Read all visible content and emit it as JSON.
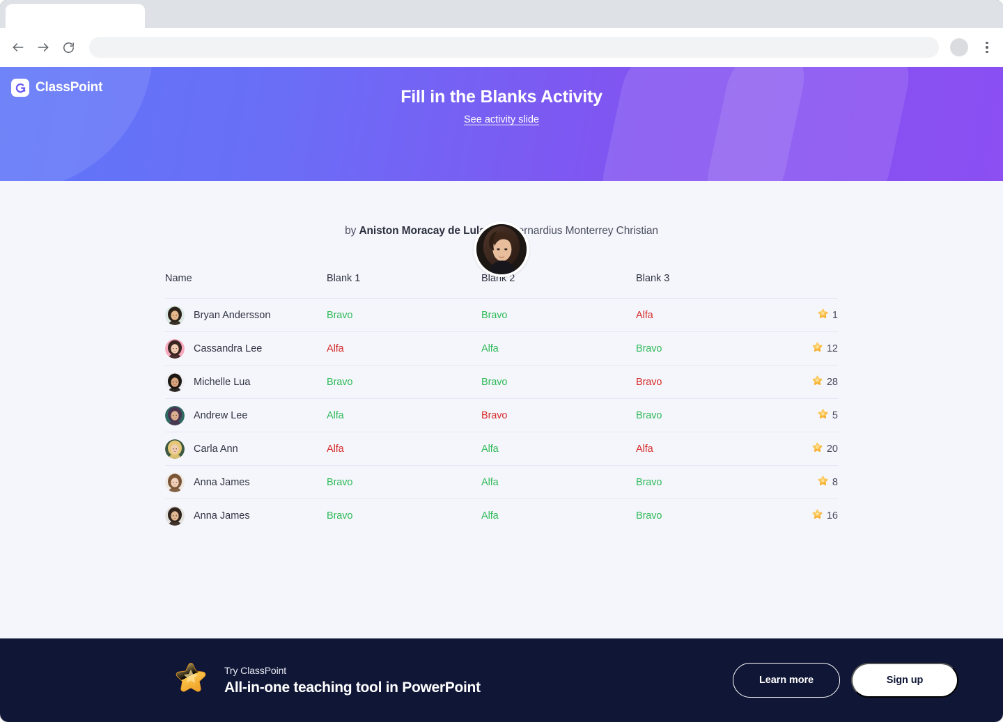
{
  "browser": {
    "tab_title": "",
    "url": "",
    "url_placeholder": "",
    "back_icon": "back-arrow-icon",
    "forward_icon": "forward-arrow-icon",
    "reload_icon": "reload-icon",
    "profile_icon": "profile-avatar-icon",
    "menu_icon": "kebab-menu-icon"
  },
  "header": {
    "brand": "ClassPoint",
    "brand_mark": "classpoint-logo-icon",
    "title": "Fill in the Blanks Activity",
    "link_label": "See activity slide",
    "avatar_alt": "presenter-avatar",
    "gradient_from": "#5f76f8",
    "gradient_to": "#8b4ff2"
  },
  "byline": {
    "prefix": "by",
    "author": "Aniston Moracay de Lula",
    "separator": "|",
    "school": "St. Bernardius Monterrey Christian"
  },
  "table": {
    "columns": [
      "Name",
      "Blank 1",
      "Blank 2",
      "Blank 3",
      ""
    ],
    "rows": [
      {
        "name": "Bryan Andersson",
        "avatar_colors": [
          "#dbe8e4",
          "#2b2218",
          "#e8b98f"
        ],
        "answers": [
          {
            "text": "Bravo",
            "correct": true
          },
          {
            "text": "Bravo",
            "correct": true
          },
          {
            "text": "Alfa",
            "correct": false
          }
        ],
        "score": "1"
      },
      {
        "name": "Cassandra Lee",
        "avatar_colors": [
          "#f7a8bd",
          "#3a2420",
          "#f2cdb4"
        ],
        "answers": [
          {
            "text": "Alfa",
            "correct": false
          },
          {
            "text": "Alfa",
            "correct": true
          },
          {
            "text": "Bravo",
            "correct": true
          }
        ],
        "score": "12"
      },
      {
        "name": "Michelle Lua",
        "avatar_colors": [
          "#efeef2",
          "#1d1713",
          "#d9a57e"
        ],
        "answers": [
          {
            "text": "Bravo",
            "correct": true
          },
          {
            "text": "Bravo",
            "correct": true
          },
          {
            "text": "Bravo",
            "correct": false
          }
        ],
        "score": "28"
      },
      {
        "name": "Andrew Lee",
        "avatar_colors": [
          "#2f6a63",
          "#4a3550",
          "#dcae90"
        ],
        "answers": [
          {
            "text": "Alfa",
            "correct": true
          },
          {
            "text": "Bravo",
            "correct": false
          },
          {
            "text": "Bravo",
            "correct": true
          }
        ],
        "score": "5"
      },
      {
        "name": "Carla Ann",
        "avatar_colors": [
          "#3f5a43",
          "#e5c877",
          "#f0cdb2"
        ],
        "answers": [
          {
            "text": "Alfa",
            "correct": false
          },
          {
            "text": "Alfa",
            "correct": true
          },
          {
            "text": "Alfa",
            "correct": false
          }
        ],
        "score": "20"
      },
      {
        "name": "Anna James",
        "avatar_colors": [
          "#efe9e4",
          "#7b5636",
          "#f3d2bc"
        ],
        "answers": [
          {
            "text": "Bravo",
            "correct": true
          },
          {
            "text": "Alfa",
            "correct": true
          },
          {
            "text": "Bravo",
            "correct": true
          }
        ],
        "score": "8"
      },
      {
        "name": "Anna James",
        "avatar_colors": [
          "#e4e2df",
          "#31241c",
          "#e0b892"
        ],
        "answers": [
          {
            "text": "Bravo",
            "correct": true
          },
          {
            "text": "Alfa",
            "correct": true
          },
          {
            "text": "Bravo",
            "correct": true
          }
        ],
        "score": "16"
      }
    ],
    "correct_color": "#2fba5a",
    "wrong_color": "#d52b2b",
    "star_icon": "star-icon"
  },
  "banner": {
    "star_icon": "gold-star-icon",
    "kicker": "Try ClassPoint",
    "headline": "All-in-one teaching tool in PowerPoint",
    "learn_more_label": "Learn more",
    "sign_up_label": "Sign up",
    "background": "#101636"
  }
}
